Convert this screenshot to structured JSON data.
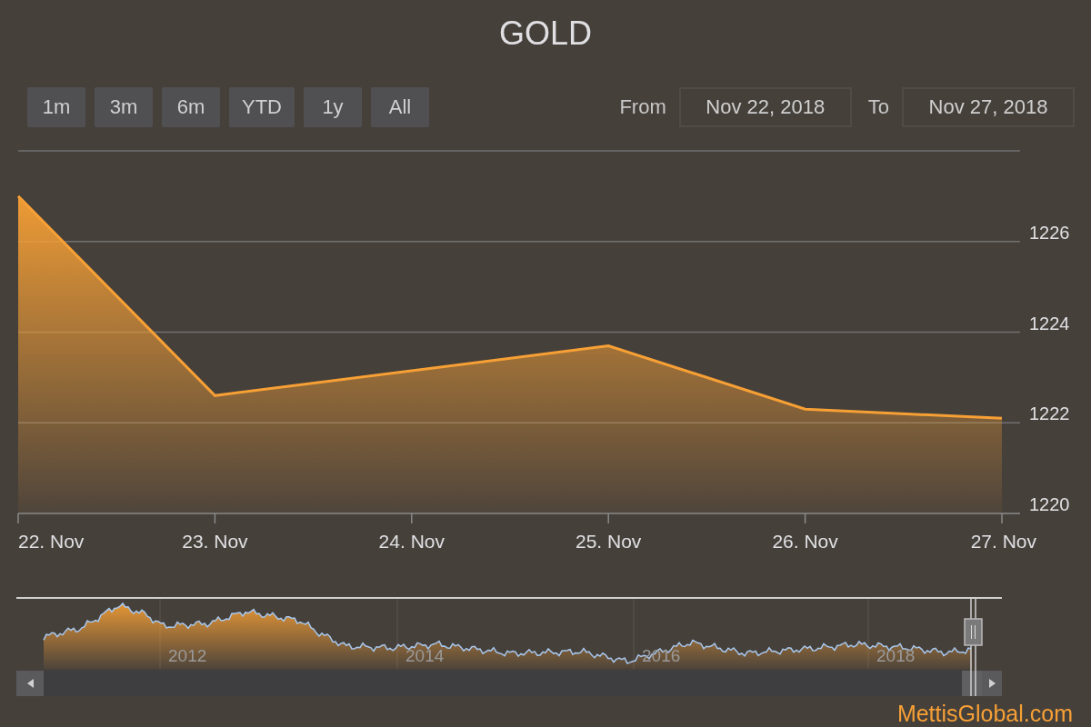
{
  "title": "GOLD",
  "range_selector": {
    "buttons": [
      {
        "label": "1m",
        "selected": false
      },
      {
        "label": "3m",
        "selected": false
      },
      {
        "label": "6m",
        "selected": false
      },
      {
        "label": "YTD",
        "selected": false
      },
      {
        "label": "1y",
        "selected": false
      },
      {
        "label": "All",
        "selected": false
      }
    ],
    "from_label": "From",
    "from_value": "Nov 22, 2018",
    "to_label": "To",
    "to_value": "Nov 27, 2018"
  },
  "chart": {
    "chart_data": {
      "type": "area",
      "categories": [
        "22. Nov",
        "23. Nov",
        "24. Nov",
        "25. Nov",
        "26. Nov",
        "27. Nov"
      ],
      "series": [
        {
          "color": "#f7a035",
          "values": [
            1227.0,
            1222.6,
            null,
            1223.7,
            1222.3,
            1222.1
          ]
        }
      ],
      "ylim": [
        1220,
        1228
      ],
      "grid": true,
      "yticks": [
        1220,
        1222,
        1224,
        1226
      ]
    }
  },
  "navigator": {
    "year_labels": [
      "2012",
      "2014",
      "2016",
      "2018"
    ]
  },
  "credits": "MettisGlobal.com"
}
